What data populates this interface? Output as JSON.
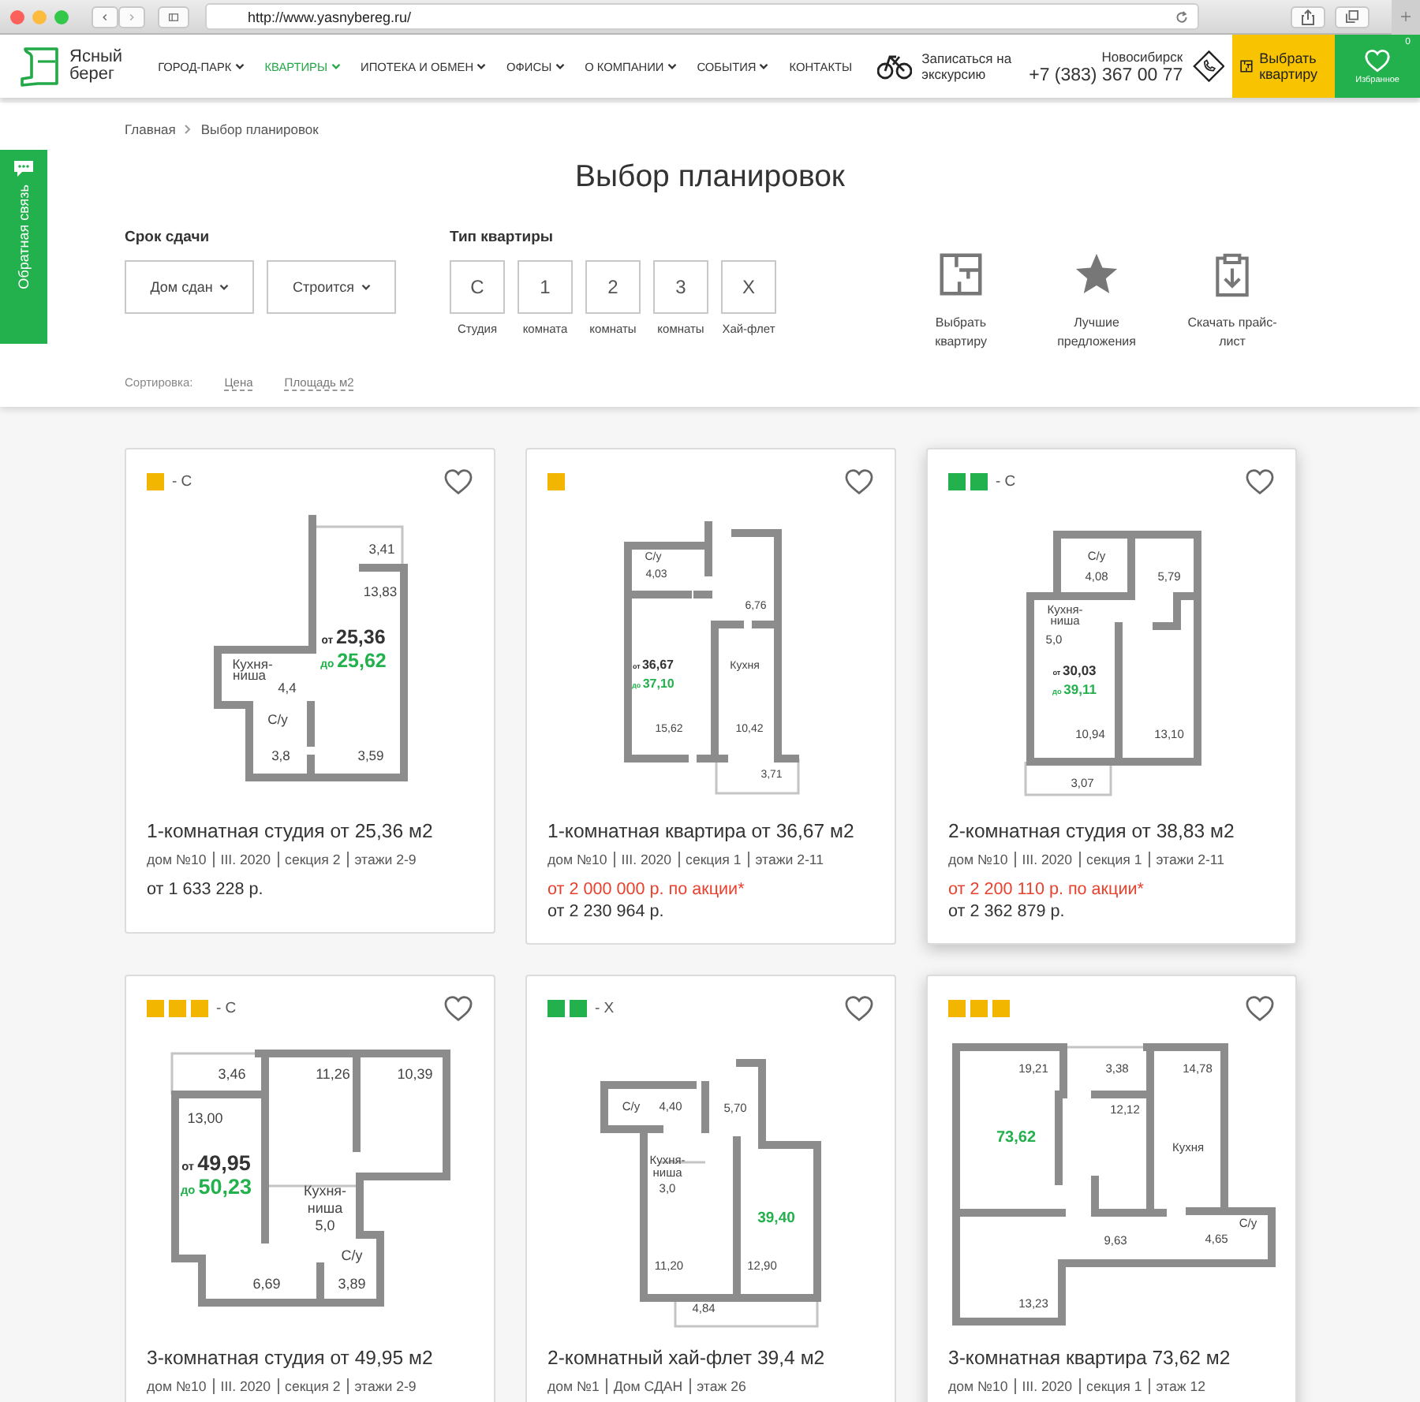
{
  "browser": {
    "url": "http://www.yasnybereg.ru/"
  },
  "header": {
    "logo": [
      "Ясный",
      "берег"
    ],
    "nav": [
      {
        "label": "ГОРОД-ПАРК",
        "selected": false,
        "dropdown": true
      },
      {
        "label": "КВАРТИРЫ",
        "selected": true,
        "dropdown": true
      },
      {
        "label": "ИПОТЕКА И ОБМЕН",
        "selected": false,
        "dropdown": true
      },
      {
        "label": "ОФИСЫ",
        "selected": false,
        "dropdown": true
      },
      {
        "label": "О КОМПАНИИ",
        "selected": false,
        "dropdown": true
      },
      {
        "label": "СОБЫТИЯ",
        "selected": false,
        "dropdown": true
      },
      {
        "label": "КОНТАКТЫ",
        "selected": false,
        "dropdown": false
      }
    ],
    "excursion": "Записаться на экскурсию",
    "city": "Новосибирск",
    "phone": "+7 (383) 367 00 77",
    "choose_button": "Выбрать квартиру",
    "favorites": {
      "label": "Избранное",
      "count": "0"
    }
  },
  "feedback_tab": "Обратная связь",
  "breadcrumbs": [
    "Главная",
    "Выбор планировок"
  ],
  "title": "Выбор планировок",
  "filters": {
    "deadline": {
      "label": "Срок сдачи",
      "options": [
        "Дом сдан",
        "Строится"
      ]
    },
    "type": {
      "label": "Тип квартиры",
      "options": [
        {
          "code": "С",
          "caption": "Студия",
          "selected": false
        },
        {
          "code": "1",
          "caption": "комната",
          "selected": false
        },
        {
          "code": "2",
          "caption": "комнаты",
          "selected": false
        },
        {
          "code": "3",
          "caption": "комнаты",
          "selected": false
        },
        {
          "code": "Х",
          "caption": "Хай-флет",
          "selected": false
        }
      ]
    }
  },
  "actions": [
    {
      "kind": "plan",
      "label": "Выбрать квартиру"
    },
    {
      "kind": "star",
      "label": "Лучшие предложения"
    },
    {
      "kind": "download",
      "label": "Скачать прайс-лист"
    }
  ],
  "sort": {
    "label": "Сортировка:",
    "options": [
      {
        "label": "Цена",
        "selected": false
      },
      {
        "label": "Площадь м2",
        "selected": false
      }
    ]
  },
  "cards": [
    {
      "rooms": [
        {
          "color": "#f2b600"
        }
      ],
      "suffix": "- С",
      "favorite": false,
      "raised": false,
      "plan": {
        "labels": [
          "3,41",
          "13,83",
          "Кухня-",
          "ниша",
          "4,4",
          "С/у",
          "3,8",
          "3,59"
        ],
        "area": [
          {
            "kind": "from",
            "prefix": "от",
            "value": "25,36"
          },
          {
            "kind": "to",
            "prefix": "до",
            "value": "25,62"
          }
        ]
      },
      "title": "1-комнатная студия от 25,36 м2",
      "meta": [
        "дом №10",
        "III. 2020",
        "секция 2",
        "этажи 2-9"
      ],
      "price": "от 1 633 228 р."
    },
    {
      "rooms": [
        {
          "color": "#f2b600"
        }
      ],
      "favorite": false,
      "raised": false,
      "plan": {
        "labels": [
          "С/у",
          "4,03",
          "6,76",
          "Кухня",
          "15,62",
          "10,42",
          "3,71"
        ],
        "area": [
          {
            "kind": "from",
            "prefix": "от",
            "value": "36,67"
          },
          {
            "kind": "to",
            "prefix": "до",
            "value": "37,10"
          }
        ]
      },
      "title": "1-комнатная квартира от 36,67 м2",
      "meta": [
        "дом №10",
        "III. 2020",
        "секция 1",
        "этажи 2-11"
      ],
      "promo": "от 2 000 000 р. по акции*",
      "price": "от 2 230 964 р."
    },
    {
      "rooms": [
        {
          "color": "#22b14c"
        },
        {
          "color": "#22b14c"
        }
      ],
      "suffix": "- С",
      "favorite": false,
      "raised": true,
      "plan": {
        "labels": [
          "С/у",
          "4,08",
          "5,79",
          "Кухня-",
          "ниша",
          "5,0",
          "10,94",
          "13,10",
          "3,07"
        ],
        "area": [
          {
            "kind": "from",
            "prefix": "от",
            "value": "30,03"
          },
          {
            "kind": "to",
            "prefix": "до",
            "value": "39,11"
          }
        ]
      },
      "title": "2-комнатная студия от 38,83 м2",
      "meta": [
        "дом №10",
        "III. 2020",
        "секция 1",
        "этажи 2-11"
      ],
      "promo": "от 2 200 110 р. по акции*",
      "price": "от 2 362 879 р."
    },
    {
      "rooms": [
        {
          "color": "#f2b600"
        },
        {
          "color": "#f2b600"
        },
        {
          "color": "#f2b600"
        }
      ],
      "suffix": "- С",
      "favorite": false,
      "raised": false,
      "plan": {
        "labels": [
          "3,46",
          "11,26",
          "10,39",
          "13,00",
          "Кухня-",
          "ниша",
          "5,0",
          "С/у",
          "6,69",
          "3,89"
        ],
        "area": [
          {
            "kind": "from",
            "prefix": "от",
            "value": "49,95"
          },
          {
            "kind": "to",
            "prefix": "до",
            "value": "50,23"
          }
        ]
      },
      "title": "3-комнатная студия от 49,95 м2",
      "meta": [
        "дом №10",
        "III. 2020",
        "секция 2",
        "этажи 2-9"
      ]
    },
    {
      "rooms": [
        {
          "color": "#22b14c"
        },
        {
          "color": "#22b14c"
        }
      ],
      "suffix": "- Х",
      "favorite": false,
      "raised": false,
      "plan": {
        "labels": [
          "С/у",
          "4,40",
          "5,70",
          "Кухня-",
          "ниша",
          "3,0",
          "11,20",
          "12,90",
          "4,84"
        ],
        "area": [
          {
            "kind": "to",
            "value": "39,40"
          }
        ]
      },
      "title": "2-комнатный хай-флет 39,4 м2",
      "meta": [
        "дом №1",
        "Дом СДАН",
        "этаж 26"
      ]
    },
    {
      "rooms": [
        {
          "color": "#f2b600"
        },
        {
          "color": "#f2b600"
        },
        {
          "color": "#f2b600"
        }
      ],
      "favorite": false,
      "raised": true,
      "plan": {
        "labels": [
          "19,21",
          "3,38",
          "14,78",
          "12,12",
          "Кухня",
          "9,63",
          "С/у",
          "4,65",
          "13,23"
        ],
        "area": [
          {
            "kind": "to",
            "value": "73,62"
          }
        ]
      },
      "title": "3-комнатная квартира 73,62 м2",
      "meta": [
        "дом №10",
        "III. 2020",
        "секция 1",
        "этаж 12"
      ]
    }
  ]
}
